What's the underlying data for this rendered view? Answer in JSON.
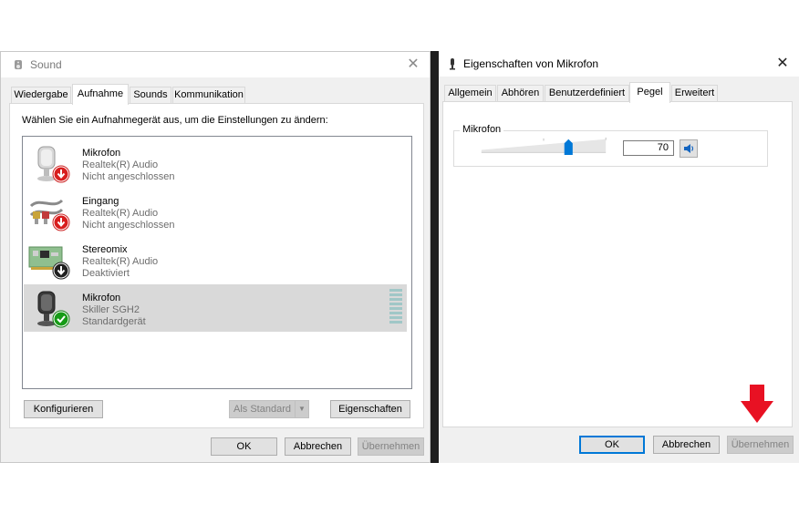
{
  "sound_dialog": {
    "title": "Sound",
    "tabs": [
      {
        "label": "Wiedergabe"
      },
      {
        "label": "Aufnahme"
      },
      {
        "label": "Sounds"
      },
      {
        "label": "Kommunikation"
      }
    ],
    "active_tab": "Aufnahme",
    "instruction": "Wählen Sie ein Aufnahmegerät aus, um die Einstellungen zu ändern:",
    "devices": [
      {
        "name": "Mikrofon",
        "driver": "Realtek(R) Audio",
        "status": "Nicht angeschlossen",
        "icon": "microphone-icon",
        "badge": "red-down-arrow-icon"
      },
      {
        "name": "Eingang",
        "driver": "Realtek(R) Audio",
        "status": "Nicht angeschlossen",
        "icon": "line-in-cable-icon",
        "badge": "red-down-arrow-icon"
      },
      {
        "name": "Stereomix",
        "driver": "Realtek(R) Audio",
        "status": "Deaktiviert",
        "icon": "sound-card-icon",
        "badge": "black-down-arrow-icon"
      },
      {
        "name": "Mikrofon",
        "driver": "Skiller SGH2",
        "status": "Standardgerät",
        "icon": "microphone-icon",
        "badge": "green-check-icon",
        "selected": true
      }
    ],
    "buttons": {
      "configure": "Konfigurieren",
      "set_default": "Als Standard",
      "properties": "Eigenschaften",
      "ok": "OK",
      "cancel": "Abbrechen",
      "apply": "Übernehmen"
    }
  },
  "properties_dialog": {
    "title": "Eigenschaften von Mikrofon",
    "tabs": [
      {
        "label": "Allgemein"
      },
      {
        "label": "Abhören"
      },
      {
        "label": "Benutzerdefiniert"
      },
      {
        "label": "Pegel"
      },
      {
        "label": "Erweitert"
      }
    ],
    "active_tab": "Pegel",
    "level": {
      "label": "Mikrofon",
      "value": "70",
      "slider_fraction": 0.7
    },
    "buttons": {
      "ok": "OK",
      "cancel": "Abbrechen",
      "apply": "Übernehmen"
    }
  },
  "colors": {
    "selection": "#d9d9d9",
    "accent": "#0078d7",
    "annotation_arrow": "#e81123"
  }
}
